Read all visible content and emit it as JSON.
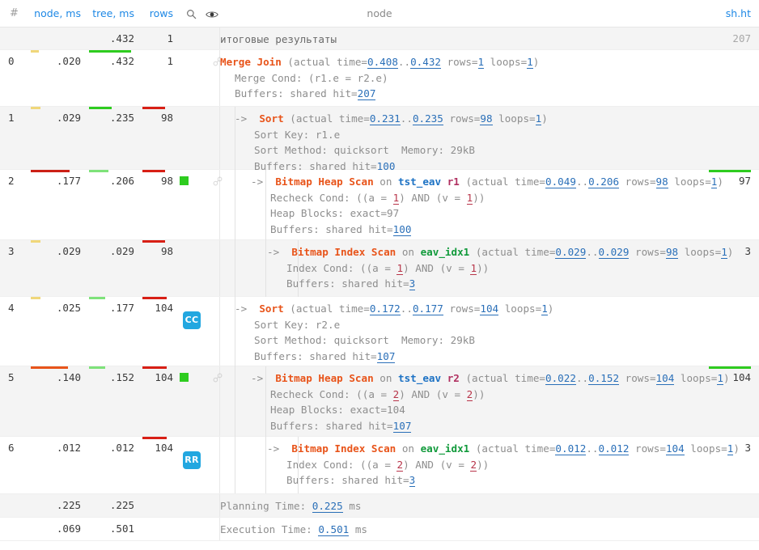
{
  "header": {
    "hash": "#",
    "node_ms": "node, ms",
    "tree_ms": "tree, ms",
    "rows": "rows",
    "search_icon": "search-icon",
    "eye_icon": "eye-icon",
    "center_title": "node",
    "right_title": "sh.ht"
  },
  "summary_row": {
    "tree": ".432",
    "rows": "1",
    "text": "итоговые результаты",
    "right": "207"
  },
  "rows": [
    {
      "idx": "0",
      "node": ".020",
      "tree": ".432",
      "rows": "1",
      "bars": {
        "node": {
          "color": "#f0d77a",
          "width": 10
        },
        "tree": {
          "color": "#2ecc1f",
          "width": 52
        },
        "rows": {
          "color": "",
          "width": 0
        }
      },
      "chain_icon": "link-icon",
      "square": null,
      "badge": null,
      "depth": 0,
      "arrow": "",
      "op": "Merge Join",
      "on": "",
      "alias": "",
      "detail": " (actual time=0.408..0.432 rows=1 loops=1)",
      "time_lo": "0.408",
      "time_hi": "0.432",
      "nrows": "1",
      "loops": "1",
      "lines": [
        "Merge Cond: (r1.e = r2.e)",
        "Buffers: shared hit=207"
      ],
      "right": "",
      "right_bar": null
    },
    {
      "idx": "1",
      "node": ".029",
      "tree": ".235",
      "rows": "98",
      "bars": {
        "node": {
          "color": "#f0d77a",
          "width": 12
        },
        "tree": {
          "color": "#2ecc1f",
          "width": 28
        },
        "rows": {
          "color": "#d81f15",
          "width": 28
        }
      },
      "chain_icon": null,
      "square": null,
      "badge": null,
      "depth": 1,
      "arrow": "->",
      "op": "Sort",
      "on": "",
      "alias": "",
      "detail": " (actual time=0.231..0.235 rows=98 loops=1)",
      "time_lo": "0.231",
      "time_hi": "0.235",
      "nrows": "98",
      "loops": "1",
      "lines": [
        "Sort Key: r1.e",
        "Sort Method: quicksort  Memory: 29kB",
        "Buffers: shared hit=100"
      ],
      "right": "",
      "right_bar": null
    },
    {
      "idx": "2",
      "node": ".177",
      "tree": ".206",
      "rows": "98",
      "bars": {
        "node": {
          "color": "#cc2016",
          "width": 48
        },
        "tree": {
          "color": "#7ee27a",
          "width": 24
        },
        "rows": {
          "color": "#d81f15",
          "width": 28
        }
      },
      "chain_icon": "link-icon",
      "square": "#2ecc1f",
      "badge": null,
      "depth": 2,
      "arrow": "->",
      "op": "Bitmap Heap Scan",
      "on": "tst_eav",
      "alias": "r1",
      "detail": " (actual time=0.049..0.206 rows=98 loops=1)",
      "time_lo": "0.049",
      "time_hi": "0.206",
      "nrows": "98",
      "loops": "1",
      "lines": [
        "Recheck Cond: ((a = 1) AND (v = 1))",
        "Heap Blocks: exact=97",
        "Buffers: shared hit=100"
      ],
      "right": "97",
      "right_bar": {
        "color": "#2ecc1f",
        "width": 52
      }
    },
    {
      "idx": "3",
      "node": ".029",
      "tree": ".029",
      "rows": "98",
      "bars": {
        "node": {
          "color": "#f0d77a",
          "width": 12
        },
        "tree": {
          "color": "",
          "width": 0
        },
        "rows": {
          "color": "#d81f15",
          "width": 28
        }
      },
      "chain_icon": null,
      "square": null,
      "badge": null,
      "depth": 3,
      "arrow": "->",
      "op": "Bitmap Index Scan",
      "on": "eav_idx1",
      "alias": "",
      "detail": " (actual time=0.029..0.029 rows=98 loops=1)",
      "time_lo": "0.029",
      "time_hi": "0.029",
      "nrows": "98",
      "loops": "1",
      "lines": [
        "Index Cond: ((a = 1) AND (v = 1))",
        "Buffers: shared hit=3"
      ],
      "right": "3",
      "right_bar": null
    },
    {
      "idx": "4",
      "node": ".025",
      "tree": ".177",
      "rows": "104",
      "bars": {
        "node": {
          "color": "#f0d77a",
          "width": 12
        },
        "tree": {
          "color": "#7ee27a",
          "width": 20
        },
        "rows": {
          "color": "#d81f15",
          "width": 30
        }
      },
      "chain_icon": null,
      "square": null,
      "badge": "CC",
      "depth": 1,
      "arrow": "->",
      "op": "Sort",
      "on": "",
      "alias": "",
      "detail": " (actual time=0.172..0.177 rows=104 loops=1)",
      "time_lo": "0.172",
      "time_hi": "0.177",
      "nrows": "104",
      "loops": "1",
      "lines": [
        "Sort Key: r2.e",
        "Sort Method: quicksort  Memory: 29kB",
        "Buffers: shared hit=107"
      ],
      "right": "",
      "right_bar": null
    },
    {
      "idx": "5",
      "node": ".140",
      "tree": ".152",
      "rows": "104",
      "bars": {
        "node": {
          "color": "#e8541a",
          "width": 46
        },
        "tree": {
          "color": "#7ee27a",
          "width": 20
        },
        "rows": {
          "color": "#d81f15",
          "width": 30
        }
      },
      "chain_icon": "link-icon",
      "square": "#2ecc1f",
      "badge": null,
      "depth": 2,
      "arrow": "->",
      "op": "Bitmap Heap Scan",
      "on": "tst_eav",
      "alias": "r2",
      "detail": " (actual time=0.022..0.152 rows=104 loops=1)",
      "time_lo": "0.022",
      "time_hi": "0.152",
      "nrows": "104",
      "loops": "1",
      "lines": [
        "Recheck Cond: ((a = 2) AND (v = 2))",
        "Heap Blocks: exact=104",
        "Buffers: shared hit=107"
      ],
      "right": "104",
      "right_bar": {
        "color": "#2ecc1f",
        "width": 52
      }
    },
    {
      "idx": "6",
      "node": ".012",
      "tree": ".012",
      "rows": "104",
      "bars": {
        "node": {
          "color": "",
          "width": 0
        },
        "tree": {
          "color": "",
          "width": 0
        },
        "rows": {
          "color": "#d81f15",
          "width": 30
        }
      },
      "chain_icon": null,
      "square": null,
      "badge": "RR",
      "depth": 3,
      "arrow": "->",
      "op": "Bitmap Index Scan",
      "on": "eav_idx1",
      "alias": "",
      "detail": " (actual time=0.012..0.012 rows=104 loops=1)",
      "time_lo": "0.012",
      "time_hi": "0.012",
      "nrows": "104",
      "loops": "1",
      "lines": [
        "Index Cond: ((a = 2) AND (v = 2))",
        "Buffers: shared hit=3"
      ],
      "right": "3",
      "right_bar": null
    }
  ],
  "footer": {
    "planning": {
      "node": ".225",
      "tree": ".225",
      "label": "Planning Time: ",
      "value": "0.225",
      "unit": " ms"
    },
    "execution": {
      "node": ".069",
      "tree": ".501",
      "label": "Execution Time: ",
      "value": "0.501",
      "unit": " ms"
    }
  }
}
